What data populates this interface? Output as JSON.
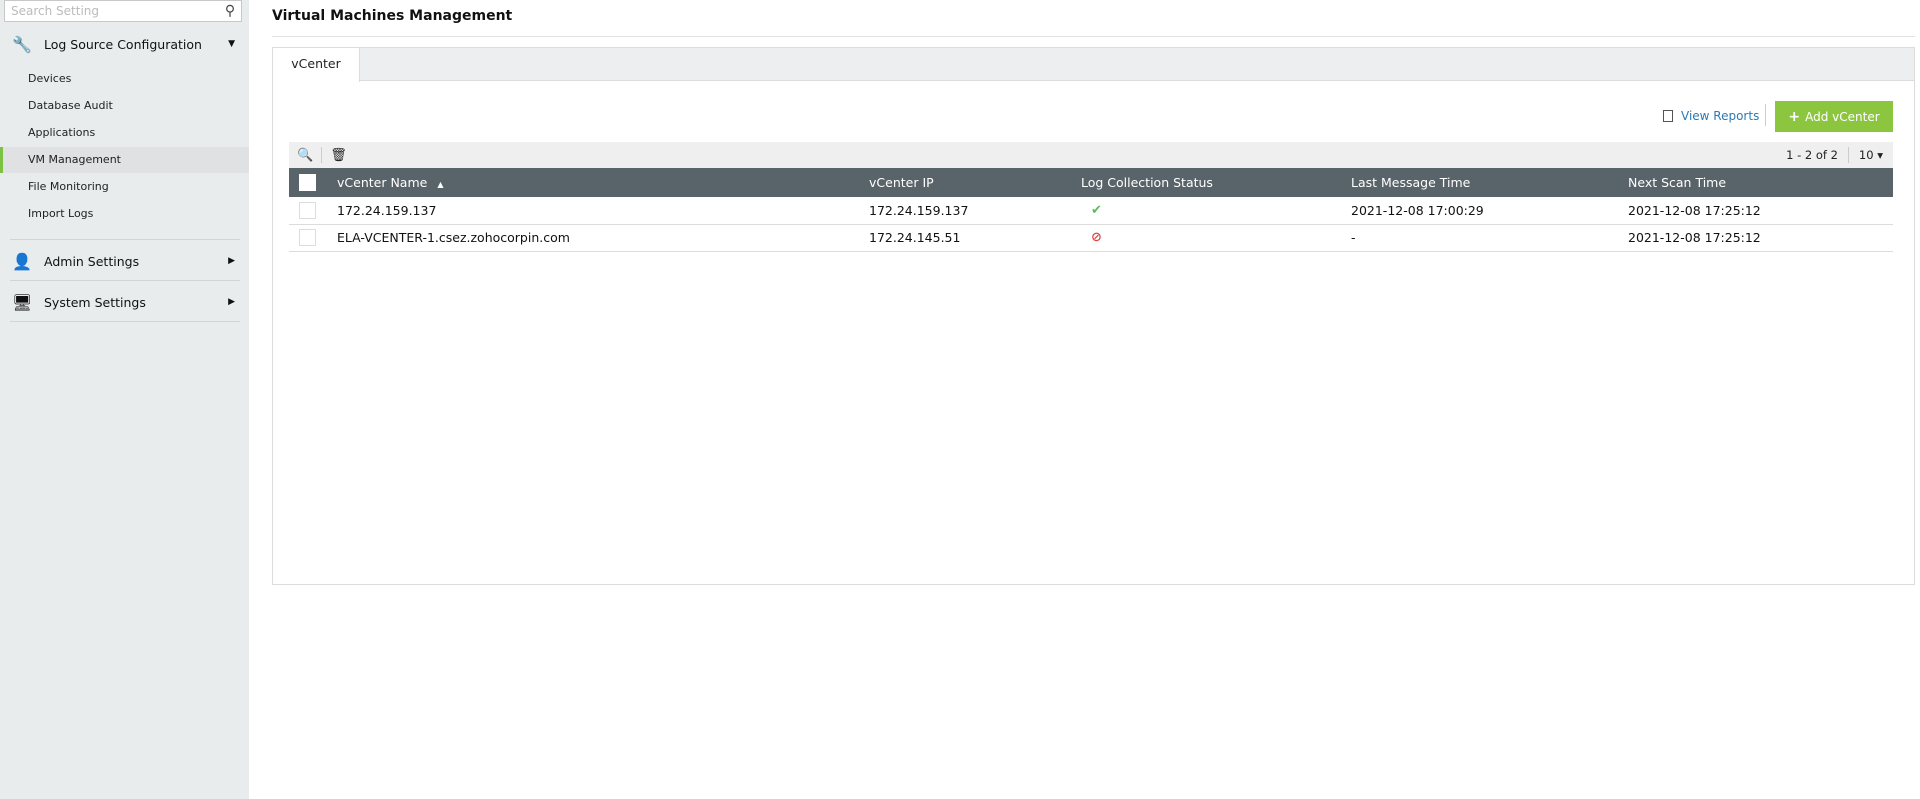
{
  "sidebar": {
    "search_placeholder": "Search Setting",
    "groups": [
      {
        "label": "Log Source Configuration",
        "icon": "tools-icon",
        "expanded": true,
        "items": [
          {
            "label": "Devices"
          },
          {
            "label": "Database Audit"
          },
          {
            "label": "Applications"
          },
          {
            "label": "VM Management",
            "active": true
          },
          {
            "label": "File Monitoring"
          },
          {
            "label": "Import Logs"
          }
        ]
      },
      {
        "label": "Admin Settings",
        "icon": "user-gear-icon"
      },
      {
        "label": "System Settings",
        "icon": "monitor-gear-icon"
      }
    ]
  },
  "page": {
    "title": "Virtual Machines Management"
  },
  "tabs": [
    {
      "label": "vCenter",
      "active": true
    }
  ],
  "toolbar": {
    "view_reports": "View Reports",
    "add_vcenter": "Add vCenter"
  },
  "pager": {
    "range": "1 - 2 of 2",
    "page_size": "10"
  },
  "table": {
    "columns": [
      "vCenter Name",
      "vCenter IP",
      "Log Collection Status",
      "Last Message Time",
      "Next Scan Time"
    ],
    "rows": [
      {
        "name": "172.24.159.137",
        "ip": "172.24.159.137",
        "status": "success",
        "last": "2021-12-08 17:00:29",
        "next": "2021-12-08 17:25:12"
      },
      {
        "name": "ELA-VCENTER-1.csez.zohocorpin.com",
        "ip": "172.24.145.51",
        "status": "stopped",
        "last": "-",
        "next": "2021-12-08 17:25:12"
      }
    ]
  },
  "colors": {
    "accent": "#8cc63f",
    "header": "#59636a",
    "success": "#5cb85c",
    "error": "#e04848",
    "link": "#2a7ab5"
  }
}
